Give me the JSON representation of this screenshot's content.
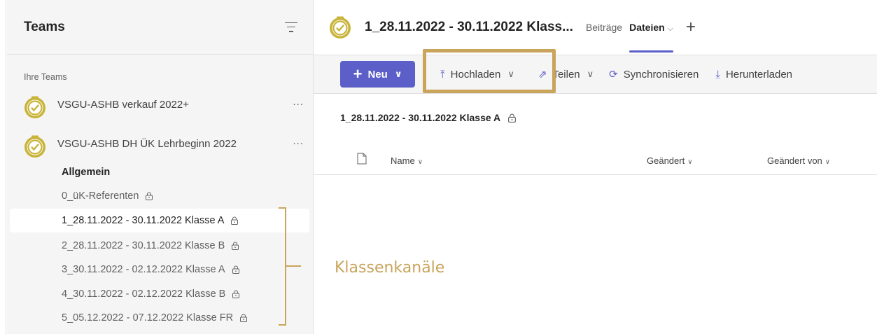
{
  "sidebar": {
    "title": "Teams",
    "section_label": "Ihre Teams",
    "teams": [
      {
        "name": "VSGU-ASHB verkauf 2022+",
        "more": "..."
      },
      {
        "name": "VSGU-ASHB DH ÜK Lehrbeginn 2022",
        "more": "..."
      }
    ],
    "channels": [
      {
        "label": "Allgemein"
      },
      {
        "label": "0_üK-Referenten"
      },
      {
        "label": "1_28.11.2022 - 30.11.2022 Klasse A"
      },
      {
        "label": "2_28.11.2022 - 30.11.2022 Klasse B"
      },
      {
        "label": "3_30.11.2022 - 02.12.2022 Klasse A"
      },
      {
        "label": "4_30.11.2022 - 02.12.2022 Klasse B"
      },
      {
        "label": "5_05.12.2022 - 07.12.2022 Klasse FR"
      }
    ]
  },
  "header": {
    "title": "1_28.11.2022 - 30.11.2022 Klass...",
    "tabs": [
      {
        "label": "Beiträge"
      },
      {
        "label": "Dateien"
      }
    ],
    "add_tab": "+"
  },
  "toolbar": {
    "new_label": "Neu",
    "upload_label": "Hochladen",
    "share_label": "Teilen",
    "sync_label": "Synchronisieren",
    "download_label": "Herunterladen"
  },
  "breadcrumb": "1_28.11.2022 - 30.11.2022 Klasse A",
  "columns": {
    "name": "Name",
    "changed": "Geändert",
    "changed_by": "Geändert von"
  },
  "annotation": "Klassenkanäle",
  "colors": {
    "accent": "#5b5fc7",
    "highlight": "#c9a55c",
    "sidebar_bg": "#f5f5f5"
  }
}
